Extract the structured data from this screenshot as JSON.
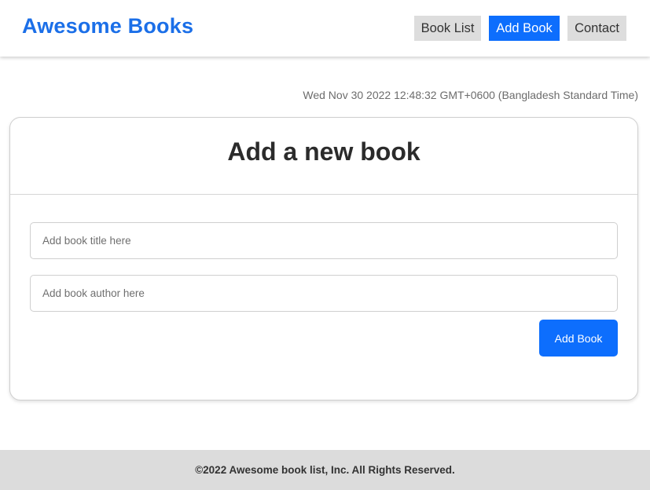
{
  "header": {
    "brand": "Awesome Books",
    "nav": {
      "book_list": "Book List",
      "add_book": "Add Book",
      "contact": "Contact",
      "active": "add_book"
    }
  },
  "datetime": "Wed Nov 30 2022 12:48:32 GMT+0600 (Bangladesh Standard Time)",
  "form": {
    "title": "Add a new book",
    "title_field": {
      "placeholder": "Add book title here",
      "value": ""
    },
    "author_field": {
      "placeholder": "Add book author here",
      "value": ""
    },
    "submit_label": "Add Book"
  },
  "footer": {
    "text": "©2022 Awesome book list, Inc. All Rights Reserved."
  },
  "colors": {
    "brand": "#1b6fe8",
    "accent": "#0d6efd",
    "nav_inactive": "#dddddd",
    "footer_bg": "#dcdcdc"
  }
}
